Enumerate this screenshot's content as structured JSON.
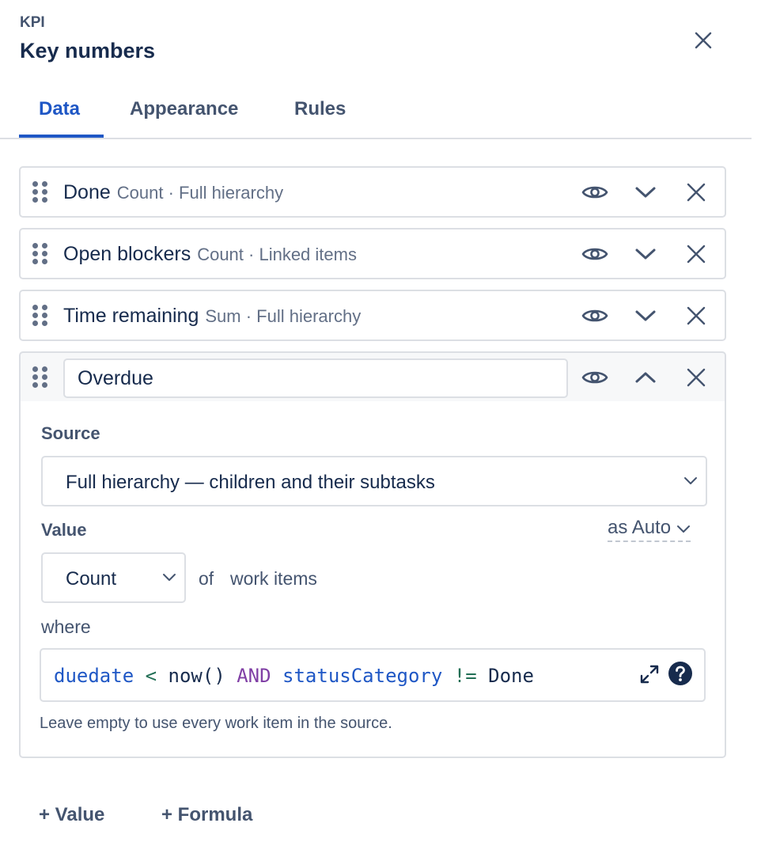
{
  "header": {
    "eyebrow": "KPI",
    "title": "Key numbers",
    "close_icon": "close-icon"
  },
  "tabs": [
    {
      "label": "Data",
      "active": true
    },
    {
      "label": "Appearance",
      "active": false
    },
    {
      "label": "Rules",
      "active": false
    }
  ],
  "values": [
    {
      "name": "Done",
      "meta": "Count · Full hierarchy",
      "expanded": false
    },
    {
      "name": "Open blockers",
      "meta": "Count · Linked items",
      "expanded": false
    },
    {
      "name": "Time remaining",
      "meta": "Sum · Full hierarchy",
      "expanded": false
    },
    {
      "name": "Overdue",
      "meta": "",
      "expanded": true
    }
  ],
  "editor": {
    "source_label": "Source",
    "source_value": "Full hierarchy — children and their subtasks",
    "value_label": "Value",
    "as_format": "as Auto",
    "aggregation": "Count",
    "of_text": "of",
    "items_text": "work items",
    "where_label": "where",
    "jql": {
      "field1": "duedate",
      "op1": "<",
      "fn1": "now()",
      "kw1": "AND",
      "field2": "statusCategory",
      "op2": "!=",
      "val2": "Done"
    },
    "help": "Leave empty to use every work item in the source."
  },
  "footer": {
    "add_value": "+ Value",
    "add_formula": "+ Formula"
  },
  "colors": {
    "accent": "#1f57c5",
    "text": "#172b4d",
    "subtle": "#44546f",
    "border": "#dcdfe4",
    "jql_keyword": "#803fa5",
    "jql_operator": "#226f55"
  }
}
